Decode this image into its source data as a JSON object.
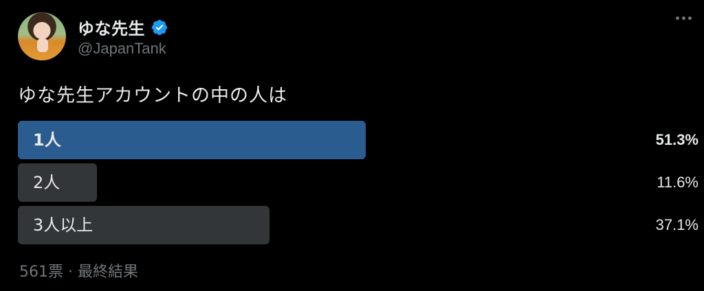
{
  "user": {
    "display_name": "ゆな先生",
    "handle": "@JapanTank"
  },
  "poll": {
    "question": "ゆな先生アカウントの中の人は",
    "options": [
      {
        "label": "1人",
        "percent_text": "51.3%",
        "percent": 51.3,
        "winner": true
      },
      {
        "label": "2人",
        "percent_text": "11.6%",
        "percent": 11.6,
        "winner": false
      },
      {
        "label": "3人以上",
        "percent_text": "37.1%",
        "percent": 37.1,
        "winner": false
      }
    ],
    "votes": "561票",
    "separator": "·",
    "status": "最終結果"
  },
  "colors": {
    "winner_bar": "#2b5c8f",
    "other_bar": "#333639",
    "verified": "#1d9bf0"
  },
  "icons": [
    "verified-badge-icon",
    "more-options-icon"
  ]
}
